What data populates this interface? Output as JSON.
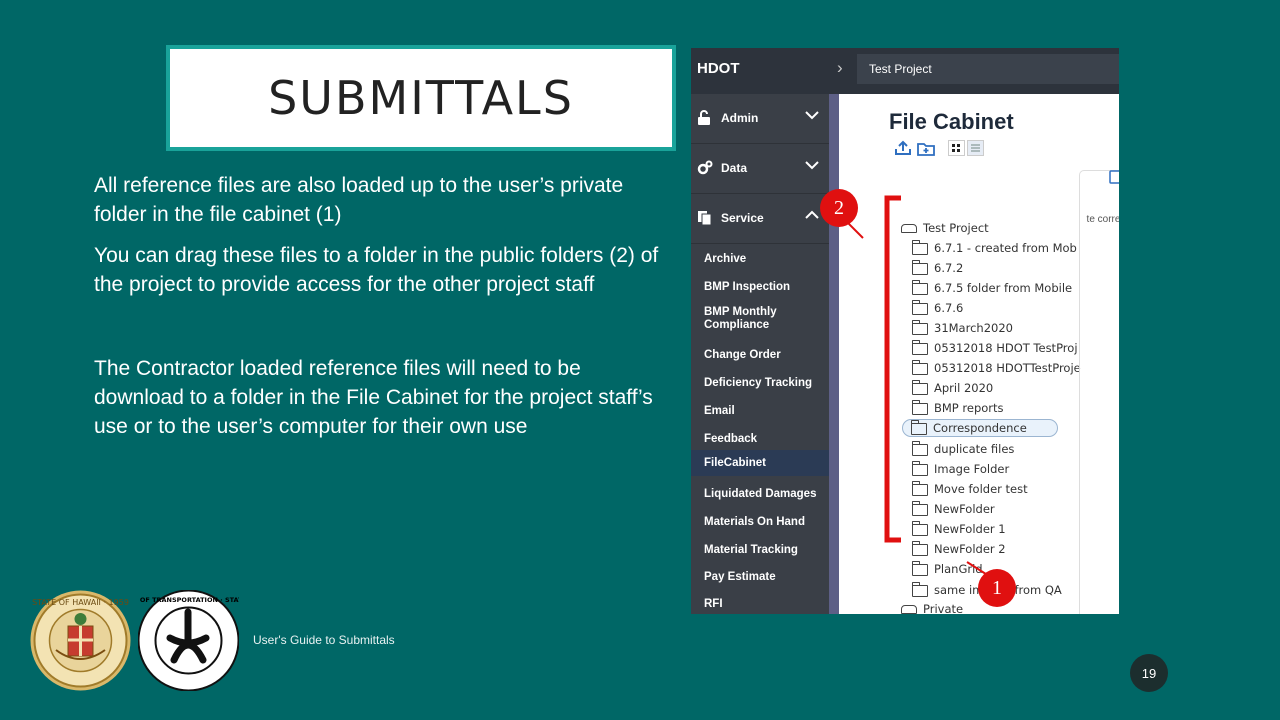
{
  "slide": {
    "title": "SUBMITTALS",
    "paragraph1": "All reference files are also loaded up to the user’s private folder in the file cabinet (1)",
    "paragraph2": "You can drag these files to a folder in the public folders (2) of the project to provide access for the other project staff",
    "paragraph3": "The Contractor loaded reference files will need to be download to a folder in the File Cabinet for the project staff’s use or to the user’s computer for their own use",
    "footer": "User's Guide to Submittals",
    "page_number": "19"
  },
  "seals": {
    "state_seal_text": "STATE OF HAWAII · 1959",
    "dot_seal_text": "DEPARTMENT OF TRANSPORTATION · STATE OF HAWAII"
  },
  "app": {
    "brand": "HDOT",
    "project_selector": "Test Project",
    "sections": [
      {
        "label": "Admin",
        "icon": "lock-icon",
        "expanded": false
      },
      {
        "label": "Data",
        "icon": "gears-icon",
        "expanded": false
      },
      {
        "label": "Service",
        "icon": "copy-icon",
        "expanded": true
      }
    ],
    "menu": [
      "Archive",
      "BMP Inspection",
      "BMP Monthly Compliance",
      "Change Order",
      "Deficiency Tracking",
      "Email",
      "Feedback",
      "FileCabinet",
      "Liquidated Damages",
      "Materials On Hand",
      "Material Tracking",
      "Pay Estimate",
      "RFI"
    ],
    "active_menu": "FileCabinet",
    "file_cabinet": {
      "title": "File Cabinet",
      "root": "Test Project",
      "folders": [
        "6.7.1 - created from Mob",
        "6.7.2",
        "6.7.5 folder from Mobile",
        "6.7.6",
        "31March2020",
        "05312018 HDOT TestProj",
        "05312018 HDOTTestProje",
        "April 2020",
        "BMP reports",
        "Correspondence",
        "duplicate files",
        "Image Folder",
        "Move folder test",
        "NewFolder",
        "NewFolder 1",
        "NewFolder 2",
        "PlanGrid",
        "same images from QA"
      ],
      "selected_folder": "Correspondence",
      "private": "Private",
      "preview_label": "te corres"
    },
    "callouts": [
      "2",
      "1"
    ],
    "colors": {
      "callout": "#e01010",
      "sidebar": "#3a3f47",
      "topbar": "#2d333c",
      "slide_bg": "#006766"
    }
  }
}
